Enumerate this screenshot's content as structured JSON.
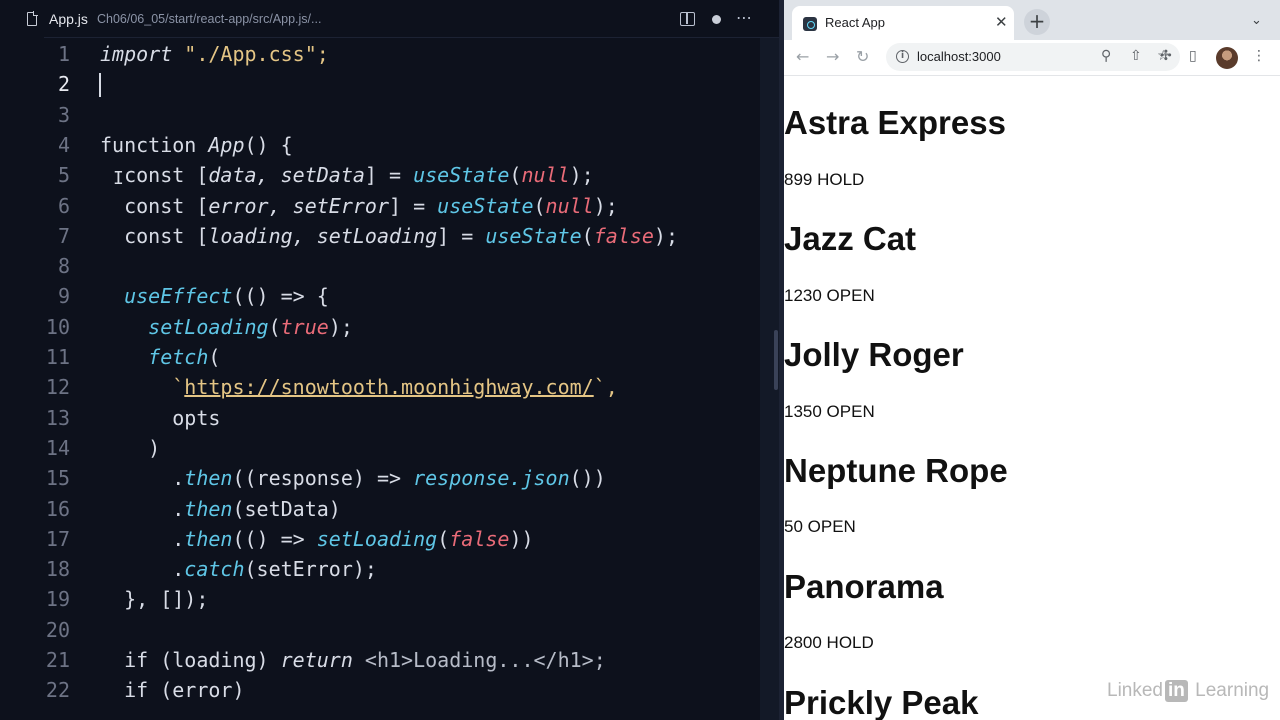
{
  "editor": {
    "tab_name": "App.js",
    "tab_path": "Ch06/06_05/start/react-app/src/App.js/...",
    "active_line": 2,
    "lines": [
      {
        "n": "1",
        "segments": [
          {
            "t": "import",
            "c": "it"
          },
          {
            "t": " \"./App.css\";",
            "c": "str"
          }
        ]
      },
      {
        "n": "2",
        "segments": []
      },
      {
        "n": "3",
        "segments": []
      },
      {
        "n": "4",
        "segments": [
          {
            "t": "function ",
            "c": "kw"
          },
          {
            "t": "App",
            "c": "it"
          },
          {
            "t": "() {",
            "c": ""
          }
        ]
      },
      {
        "n": "5",
        "segments": [
          {
            "t": "  const ",
            "c": "kw"
          },
          {
            "t": "[",
            "c": ""
          },
          {
            "t": "data, setData",
            "c": "it"
          },
          {
            "t": "] = ",
            "c": ""
          },
          {
            "t": "useState",
            "c": "fn"
          },
          {
            "t": "(",
            "c": ""
          },
          {
            "t": "null",
            "c": "lit"
          },
          {
            "t": ");",
            "c": ""
          }
        ]
      },
      {
        "n": "6",
        "segments": [
          {
            "t": "  const ",
            "c": "kw"
          },
          {
            "t": "[",
            "c": ""
          },
          {
            "t": "error, setError",
            "c": "it"
          },
          {
            "t": "] = ",
            "c": ""
          },
          {
            "t": "useState",
            "c": "fn"
          },
          {
            "t": "(",
            "c": ""
          },
          {
            "t": "null",
            "c": "lit"
          },
          {
            "t": ");",
            "c": ""
          }
        ]
      },
      {
        "n": "7",
        "segments": [
          {
            "t": "  const ",
            "c": "kw"
          },
          {
            "t": "[",
            "c": ""
          },
          {
            "t": "loading, setLoading",
            "c": "it"
          },
          {
            "t": "] = ",
            "c": ""
          },
          {
            "t": "useState",
            "c": "fn"
          },
          {
            "t": "(",
            "c": ""
          },
          {
            "t": "false",
            "c": "lit"
          },
          {
            "t": ");",
            "c": ""
          }
        ]
      },
      {
        "n": "8",
        "segments": []
      },
      {
        "n": "9",
        "segments": [
          {
            "t": "  ",
            "c": ""
          },
          {
            "t": "useEffect",
            "c": "fn"
          },
          {
            "t": "(() => {",
            "c": ""
          }
        ]
      },
      {
        "n": "10",
        "segments": [
          {
            "t": "    ",
            "c": ""
          },
          {
            "t": "setLoading",
            "c": "fn"
          },
          {
            "t": "(",
            "c": ""
          },
          {
            "t": "true",
            "c": "lit"
          },
          {
            "t": ");",
            "c": ""
          }
        ]
      },
      {
        "n": "11",
        "segments": [
          {
            "t": "    ",
            "c": ""
          },
          {
            "t": "fetch",
            "c": "fn"
          },
          {
            "t": "(",
            "c": ""
          }
        ]
      },
      {
        "n": "12",
        "segments": [
          {
            "t": "      `",
            "c": "str"
          },
          {
            "t": "https://snowtooth.moonhighway.com/",
            "c": "url"
          },
          {
            "t": "`,",
            "c": "str"
          }
        ]
      },
      {
        "n": "13",
        "segments": [
          {
            "t": "      opts",
            "c": ""
          }
        ]
      },
      {
        "n": "14",
        "segments": [
          {
            "t": "    )",
            "c": ""
          }
        ]
      },
      {
        "n": "15",
        "segments": [
          {
            "t": "      .",
            "c": ""
          },
          {
            "t": "then",
            "c": "fn"
          },
          {
            "t": "((response) => ",
            "c": ""
          },
          {
            "t": "response.json",
            "c": "fn"
          },
          {
            "t": "())",
            "c": ""
          }
        ]
      },
      {
        "n": "16",
        "segments": [
          {
            "t": "      .",
            "c": ""
          },
          {
            "t": "then",
            "c": "fn"
          },
          {
            "t": "(setData)",
            "c": ""
          }
        ]
      },
      {
        "n": "17",
        "segments": [
          {
            "t": "      .",
            "c": ""
          },
          {
            "t": "then",
            "c": "fn"
          },
          {
            "t": "(() => ",
            "c": ""
          },
          {
            "t": "setLoading",
            "c": "fn"
          },
          {
            "t": "(",
            "c": ""
          },
          {
            "t": "false",
            "c": "lit"
          },
          {
            "t": "))",
            "c": ""
          }
        ]
      },
      {
        "n": "18",
        "segments": [
          {
            "t": "      .",
            "c": ""
          },
          {
            "t": "catch",
            "c": "fn"
          },
          {
            "t": "(setError);",
            "c": ""
          }
        ]
      },
      {
        "n": "19",
        "segments": [
          {
            "t": "  }, []);",
            "c": ""
          }
        ]
      },
      {
        "n": "20",
        "segments": []
      },
      {
        "n": "21",
        "segments": [
          {
            "t": "  if ",
            "c": "kw"
          },
          {
            "t": "(loading) ",
            "c": ""
          },
          {
            "t": "return",
            "c": "it"
          },
          {
            "t": " <h1>Loading...</h1>;",
            "c": "tag"
          }
        ]
      },
      {
        "n": "22",
        "segments": [
          {
            "t": "  if ",
            "c": "kw"
          },
          {
            "t": "(error)",
            "c": ""
          }
        ]
      }
    ]
  },
  "browser": {
    "tab_title": "React App",
    "close_glyph": "✕",
    "newtab_glyph": "+",
    "chevron_glyph": "⌄",
    "url": "localhost:3000",
    "nav": {
      "back": "←",
      "forward": "→",
      "reload": "↻"
    },
    "icons": [
      "zoom-icon",
      "share-icon",
      "star-icon",
      "extensions-icon",
      "sidepanel-icon",
      "avatar",
      "menu-icon"
    ]
  },
  "lifts": [
    {
      "name": "Astra Express",
      "status": "899 HOLD"
    },
    {
      "name": "Jazz Cat",
      "status": "1230 OPEN"
    },
    {
      "name": "Jolly Roger",
      "status": "1350 OPEN"
    },
    {
      "name": "Neptune Rope",
      "status": "50 OPEN"
    },
    {
      "name": "Panorama",
      "status": "2800 HOLD"
    },
    {
      "name": "Prickly Peak",
      "status": ""
    }
  ],
  "watermark": {
    "pre": "Linked",
    "in": "in",
    "post": " Learning"
  }
}
